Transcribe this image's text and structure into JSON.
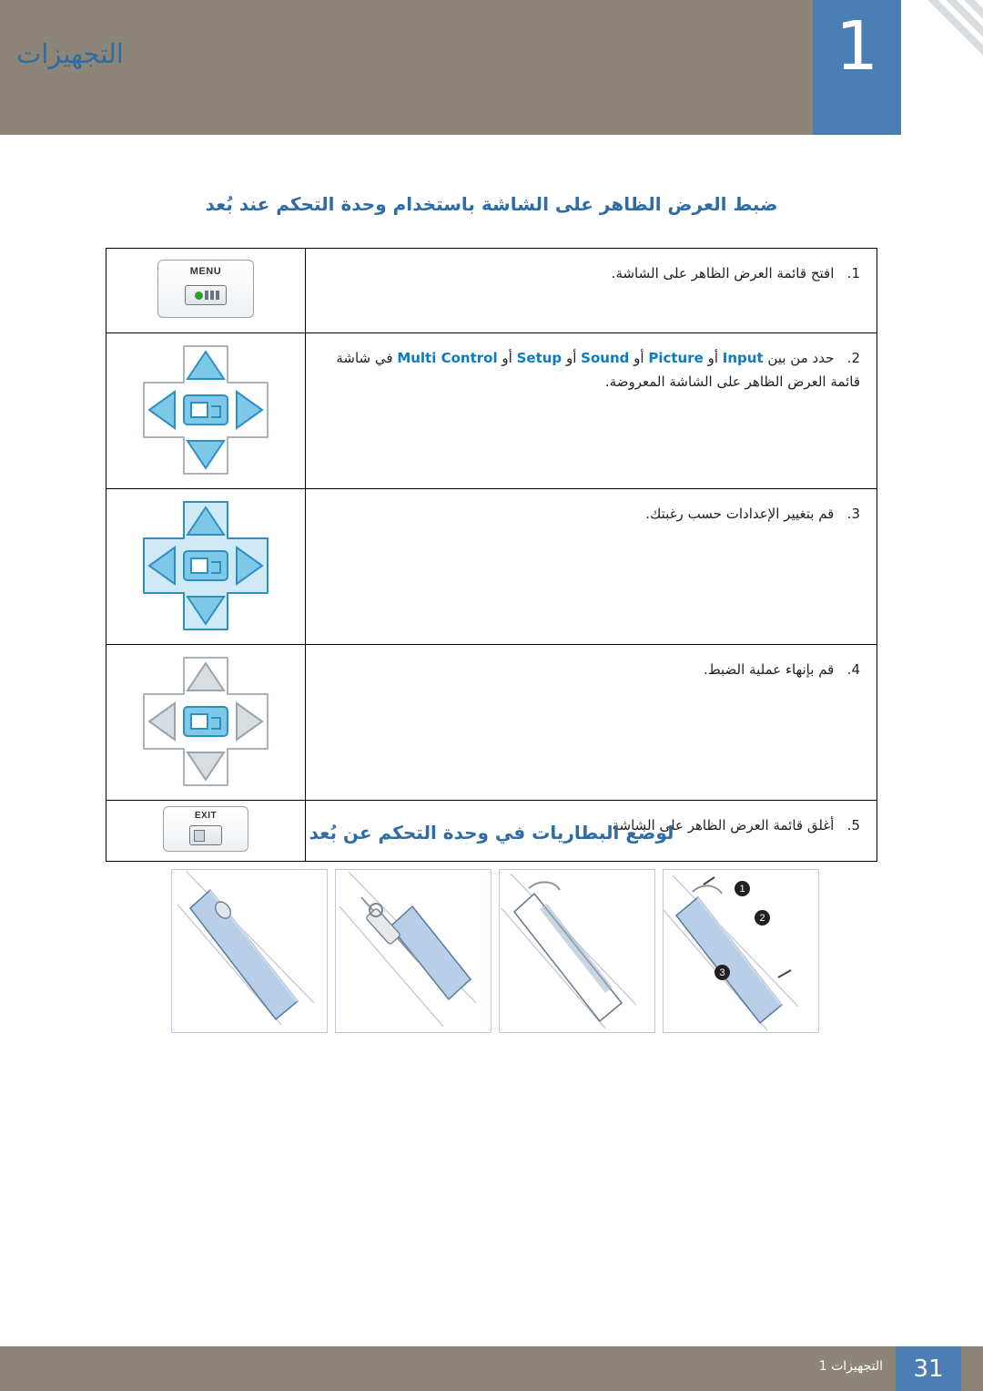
{
  "header": {
    "chapter_number": "1",
    "title": "التجهيزات"
  },
  "headings": {
    "osd_adjust": "ضبط العرض الظاهر على الشاشة باستخدام وحدة التحكم عند بُعد",
    "batteries": "لوضع البطاريات في وحدة التحكم عن بُعد"
  },
  "steps": [
    {
      "number": "1.",
      "text": "افتح قائمة العرض الظاهر على الشاشة.",
      "button": "MENU"
    },
    {
      "number": "2.",
      "text_before": "حدد من بين",
      "menu_items": [
        "Input",
        "أو",
        "Picture",
        "أو",
        "Sound",
        "أو",
        "Setup",
        "أو",
        "Multi Control"
      ],
      "text_after": "في شاشة قائمة العرض الظاهر على الشاشة المعروضة.",
      "full_text": "حدد من بين Input أو Picture أو Sound أو Setup أو Multi Control في شاشة قائمة العرض الظاهر على الشاشة المعروضة.",
      "button": "dpad-neutral"
    },
    {
      "number": "3.",
      "text": "قم بتغيير الإعدادات حسب رغبتك.",
      "button": "dpad-highlight"
    },
    {
      "number": "4.",
      "text": "قم بإنهاء عملية الضبط.",
      "button": "dpad-enter"
    },
    {
      "number": "5.",
      "text": "أغلق قائمة العرض الظاهر على الشاشة.",
      "button": "EXIT"
    }
  ],
  "menu_labels": {
    "input": "Input",
    "picture": "Picture",
    "sound": "Sound",
    "setup": "Setup",
    "multi_control": "Multi Control",
    "or": "أو",
    "select_from": "حدد من بين",
    "in_osd": "في شاشة قائمة العرض الظاهر على الشاشة المعروضة."
  },
  "buttons": {
    "menu_label": "MENU",
    "exit_label": "EXIT"
  },
  "battery_steps": [
    {
      "badges": [
        "1",
        "2",
        "3"
      ]
    },
    {
      "badges": []
    },
    {
      "badges": []
    },
    {
      "badges": []
    }
  ],
  "footer": {
    "text": "التجهيزات 1",
    "page": "31"
  },
  "colors": {
    "header_band": "#8d8577",
    "accent_blue": "#4a7eb5",
    "heading_blue": "#2e6ca6",
    "menu_link": "#0b7cc1",
    "dpad_blue": "#7ec8e8",
    "dpad_blue_dark": "#2e8fc4"
  }
}
